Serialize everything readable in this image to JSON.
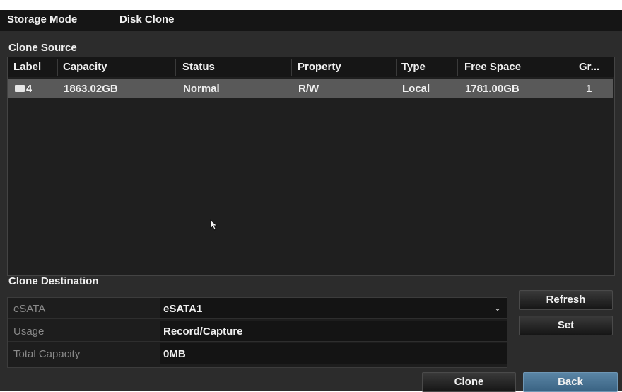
{
  "tabs": [
    {
      "label": "Storage Mode",
      "active": false
    },
    {
      "label": "Disk Clone",
      "active": true
    }
  ],
  "clone_source": {
    "title": "Clone Source",
    "columns": [
      "Label",
      "Capacity",
      "Status",
      "Property",
      "Type",
      "Free Space",
      "Gr..."
    ],
    "rows": [
      {
        "label": "4",
        "capacity": "1863.02GB",
        "status": "Normal",
        "property": "R/W",
        "type": "Local",
        "free_space": "1781.00GB",
        "group": "1",
        "selected": false
      }
    ]
  },
  "clone_destination": {
    "title": "Clone Destination",
    "fields": [
      {
        "label": "eSATA",
        "value": "eSATA1",
        "dropdown": true
      },
      {
        "label": "Usage",
        "value": "Record/Capture",
        "dropdown": false
      },
      {
        "label": "Total Capacity",
        "value": "0MB",
        "dropdown": false
      }
    ]
  },
  "buttons": {
    "refresh": "Refresh",
    "set": "Set",
    "clone": "Clone",
    "back": "Back"
  },
  "icons": {
    "dropdown": "chevron-down-icon",
    "disk": "disk-icon",
    "pointer": "mouse-pointer-icon"
  },
  "colors": {
    "background": "#2c2c2c",
    "tabbar": "#151515",
    "selected_row": "#595959",
    "back_button": "#4a7394"
  }
}
